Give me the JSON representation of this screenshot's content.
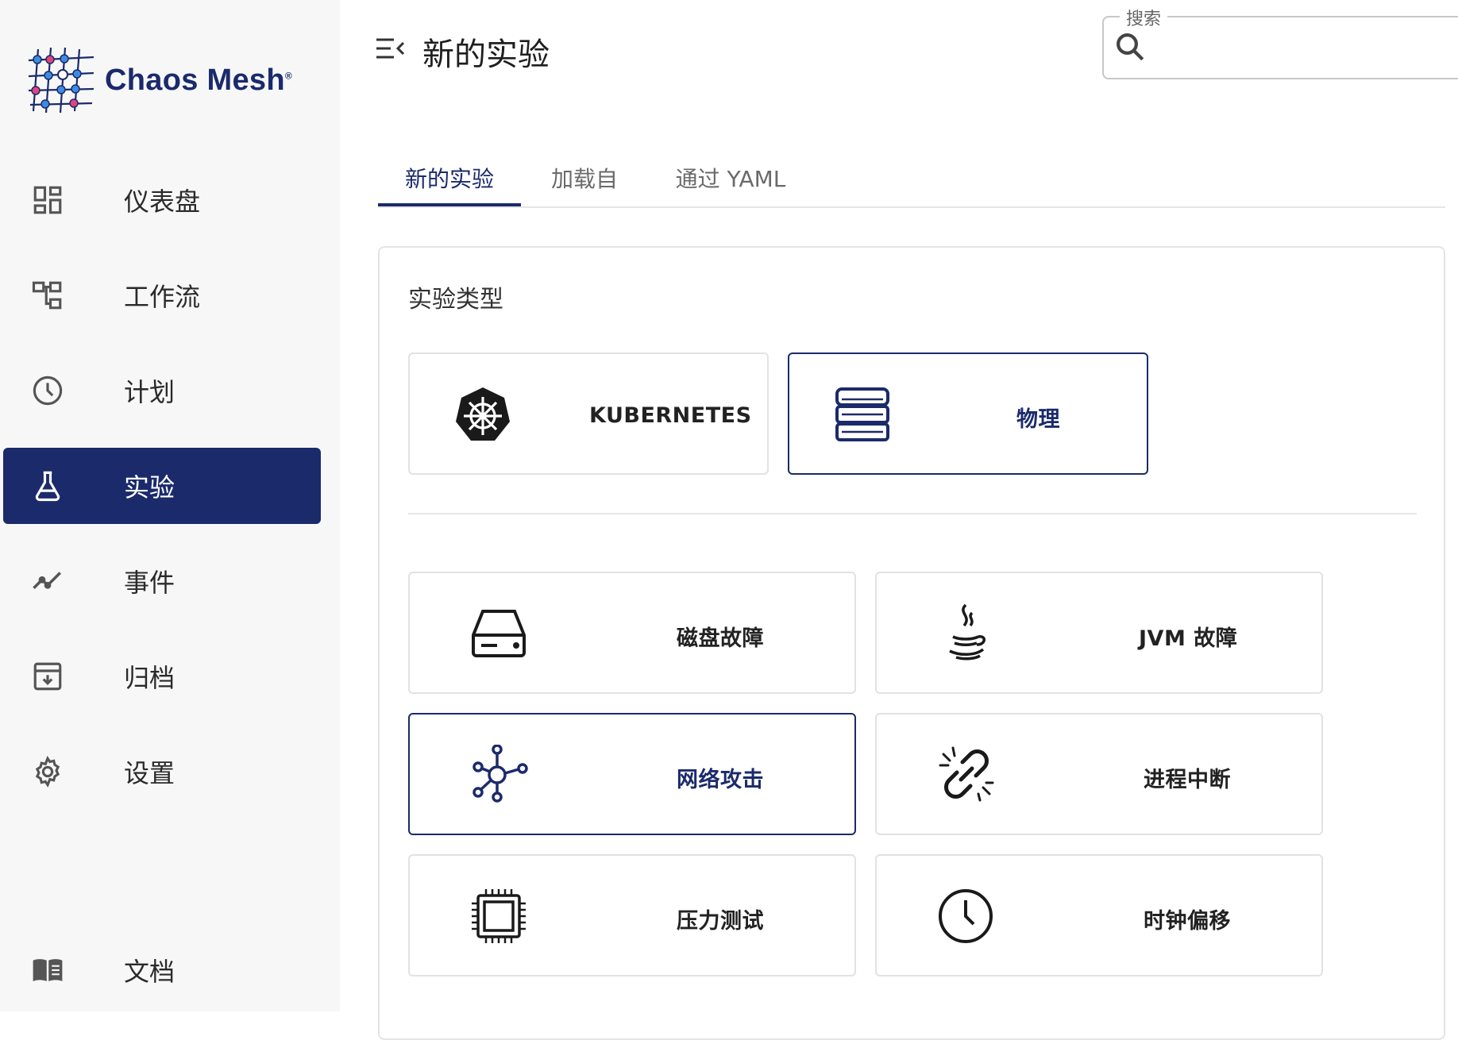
{
  "app": {
    "name": "Chaos Mesh"
  },
  "sidebar": {
    "items": [
      {
        "label": "仪表盘",
        "icon": "dashboard-icon"
      },
      {
        "label": "工作流",
        "icon": "workflow-icon"
      },
      {
        "label": "计划",
        "icon": "clock-icon"
      },
      {
        "label": "实验",
        "icon": "flask-icon",
        "active": true
      },
      {
        "label": "事件",
        "icon": "events-line-icon"
      },
      {
        "label": "归档",
        "icon": "archive-icon"
      },
      {
        "label": "设置",
        "icon": "gear-icon"
      }
    ],
    "docs": {
      "label": "文档",
      "icon": "book-icon"
    }
  },
  "header": {
    "title": "新的实验",
    "search": {
      "legend": "搜索",
      "value": ""
    }
  },
  "tabs": [
    {
      "label": "新的实验",
      "active": true
    },
    {
      "label": "加载自"
    },
    {
      "label": "通过 YAML"
    }
  ],
  "panel": {
    "section_title": "实验类型",
    "env_types": [
      {
        "label": "KUBERNETES",
        "icon": "kubernetes-icon",
        "selected": false
      },
      {
        "label": "物理",
        "icon": "server-stack-icon",
        "selected": true
      }
    ],
    "fault_types": [
      {
        "label": "磁盘故障",
        "icon": "hard-drive-icon",
        "selected": false
      },
      {
        "label": "JVM 故障",
        "icon": "java-icon",
        "selected": false
      },
      {
        "label": "网络攻击",
        "icon": "network-hub-icon",
        "selected": true
      },
      {
        "label": "进程中断",
        "icon": "broken-link-icon",
        "selected": false
      },
      {
        "label": "压力测试",
        "icon": "cpu-chip-icon",
        "selected": false
      },
      {
        "label": "时钟偏移",
        "icon": "clock-icon",
        "selected": false
      }
    ]
  },
  "colors": {
    "primary": "#1b2a6b",
    "sidebar_bg": "#f7f7f7",
    "accent_pink": "#e0457b",
    "accent_blue": "#3a8de0"
  }
}
